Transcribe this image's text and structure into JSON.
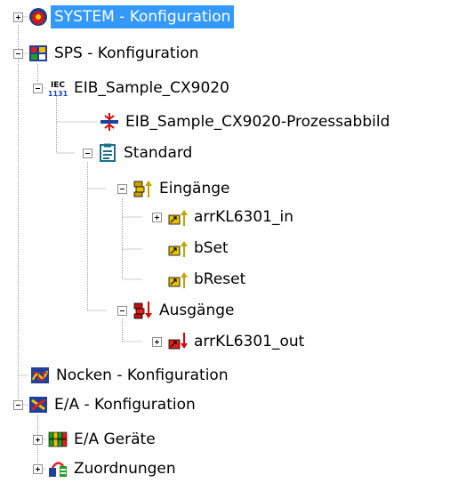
{
  "tree": {
    "nodes": [
      {
        "id": "system",
        "label": "SYSTEM - Konfiguration",
        "icon": "gear-globe-icon",
        "toggle": "collapsed",
        "selected": true
      },
      {
        "id": "sps",
        "label": "SPS - Konfiguration",
        "icon": "plc-config-icon",
        "toggle": "expanded"
      },
      {
        "id": "eib-sample",
        "label": "EIB_Sample_CX9020",
        "icon": "iec-1131-icon",
        "toggle": "expanded"
      },
      {
        "id": "prozessabbild",
        "label": "EIB_Sample_CX9020-Prozessabbild",
        "icon": "process-image-icon",
        "toggle": "none"
      },
      {
        "id": "standard",
        "label": "Standard",
        "icon": "task-standard-icon",
        "toggle": "expanded"
      },
      {
        "id": "eingaenge",
        "label": "Eingänge",
        "icon": "inputs-group-icon",
        "toggle": "expanded"
      },
      {
        "id": "arr-in",
        "label": "arrKL6301_in",
        "icon": "input-variable-icon",
        "toggle": "collapsed"
      },
      {
        "id": "bset",
        "label": "bSet",
        "icon": "input-variable-icon",
        "toggle": "none"
      },
      {
        "id": "breset",
        "label": "bReset",
        "icon": "input-variable-icon",
        "toggle": "none"
      },
      {
        "id": "ausgaenge",
        "label": "Ausgänge",
        "icon": "outputs-group-icon",
        "toggle": "expanded"
      },
      {
        "id": "arr-out",
        "label": "arrKL6301_out",
        "icon": "output-variable-icon",
        "toggle": "collapsed"
      },
      {
        "id": "nocken",
        "label": "Nocken - Konfiguration",
        "icon": "cam-config-icon",
        "toggle": "none"
      },
      {
        "id": "ea-config",
        "label": "E/A - Konfiguration",
        "icon": "io-config-icon",
        "toggle": "expanded"
      },
      {
        "id": "ea-geraete",
        "label": "E/A Geräte",
        "icon": "io-devices-icon",
        "toggle": "collapsed"
      },
      {
        "id": "zuordnungen",
        "label": "Zuordnungen",
        "icon": "mappings-icon",
        "toggle": "collapsed"
      }
    ],
    "colors": {
      "selection": "#3399ff",
      "input_arrow": "#c9a000",
      "output_arrow": "#e00000"
    }
  }
}
